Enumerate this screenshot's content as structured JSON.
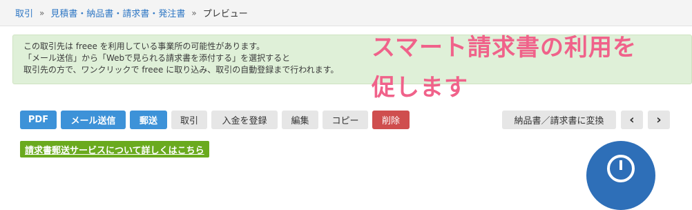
{
  "breadcrumb": {
    "items": [
      "取引",
      "見積書・納品書・請求書・発注書"
    ],
    "separator": "»",
    "current": "プレビュー"
  },
  "notice": {
    "lines": [
      "この取引先は freee を利用している事業所の可能性があります。",
      "「メール送信」から「Webで見られる請求書を添付する」を選択すると",
      "取引先の方で、ワンクリックで freee に取り込み、取引の自動登録まで行われます。"
    ]
  },
  "overlay": {
    "lines": [
      "スマート請求書の利用を",
      "促します"
    ],
    "color": "#f0628a"
  },
  "toolbar": {
    "pdf": "PDF",
    "email": "メール送信",
    "mail": "郵送",
    "transaction": "取引",
    "register_payment": "入金を登録",
    "edit": "編集",
    "copy": "コピー",
    "delete": "削除",
    "convert": "納品書／請求書に変換",
    "prev": "‹",
    "next": "›"
  },
  "mail_service_link": "請求書郵送サービスについて詳しくはこちら",
  "colors": {
    "primary_blue": "#3d92d8",
    "danger_red": "#cf4e4e",
    "notice_green": "#dff0d8",
    "link_green": "#6aaa1e"
  }
}
